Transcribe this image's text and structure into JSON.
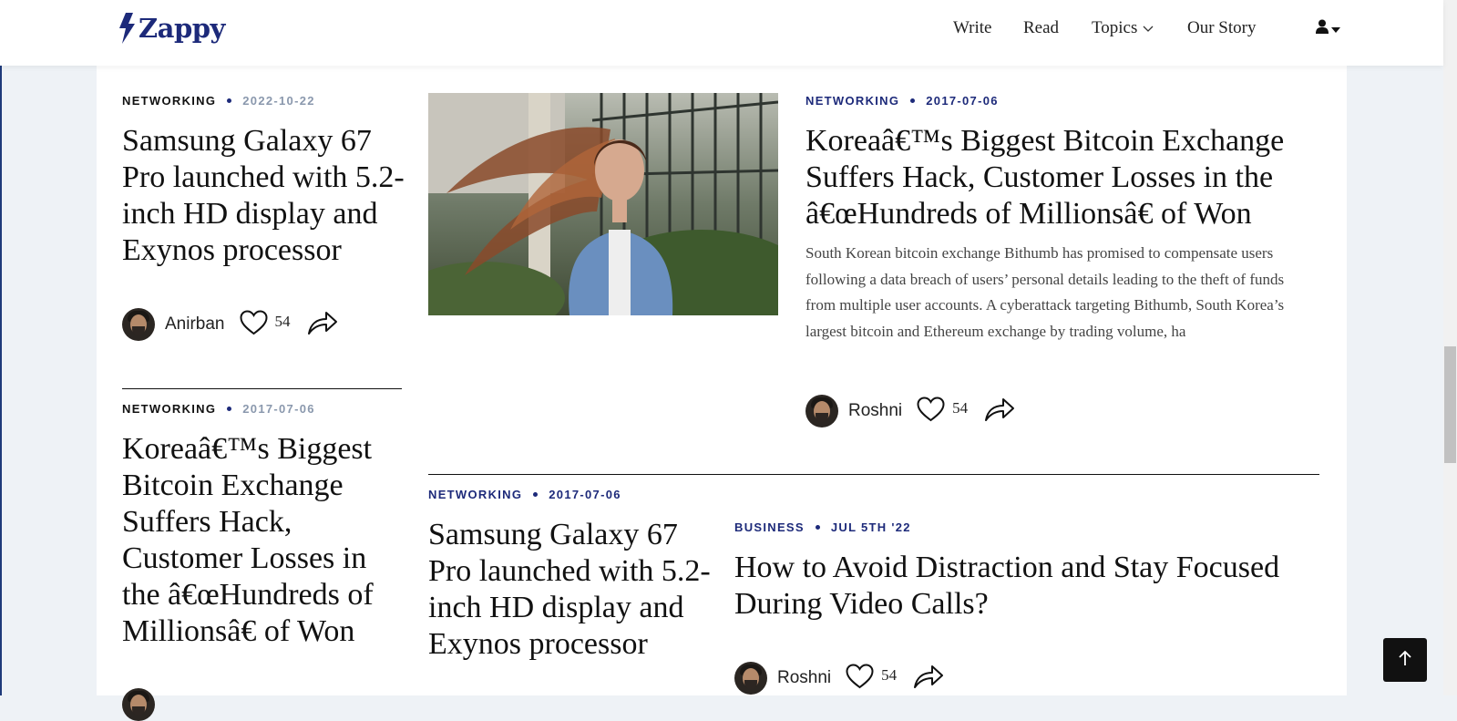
{
  "brand": {
    "name": "Zappy"
  },
  "nav": {
    "write": "Write",
    "read": "Read",
    "topics": "Topics",
    "our_story": "Our Story"
  },
  "articles": [
    {
      "category": "NETWORKING",
      "date": "2022-10-22",
      "title": "Samsung Galaxy 67 Pro launched with 5.2-inch HD display and Exynos processor",
      "author": "Anirban",
      "likes": "54"
    },
    {
      "category": "NETWORKING",
      "date": "2017-07-06",
      "title": "Koreaâ€™s Biggest Bitcoin Exchange Suffers Hack, Customer Losses in the â€œHundreds of Millionsâ€ of Won"
    },
    {
      "category": "NETWORKING",
      "date": "2017-07-06",
      "title": "Koreaâ€™s Biggest Bitcoin Exchange Suffers Hack, Customer Losses in the â€œHundreds of Millionsâ€ of Won",
      "excerpt": "South Korean bitcoin exchange Bithumb has promised to compensate users following a data breach of users’ personal details leading to the theft of funds from multiple user accounts. A cyberattack targeting Bithumb, South Korea’s largest bitcoin and Ethereum exchange by trading volume, ha",
      "author": "Roshni",
      "likes": "54"
    },
    {
      "category": "NETWORKING",
      "date": "2017-07-06",
      "title": "Samsung Galaxy 67 Pro launched with 5.2-inch HD display and Exynos processor"
    },
    {
      "category": "BUSINESS",
      "date": "JUL 5TH '22",
      "title": "How to Avoid Distraction and Stay Focused During Video Calls?",
      "author": "Roshni",
      "likes": "54"
    }
  ],
  "colors": {
    "brand": "#1d2a7a",
    "page_bg": "#eef2f6",
    "date_muted": "#8a98ad",
    "back_to_top_bg": "#111111"
  },
  "icons": [
    "bolt-icon",
    "chevron-down-icon",
    "user-icon",
    "caret-down-icon",
    "heart-icon",
    "share-icon",
    "arrow-up-icon"
  ]
}
